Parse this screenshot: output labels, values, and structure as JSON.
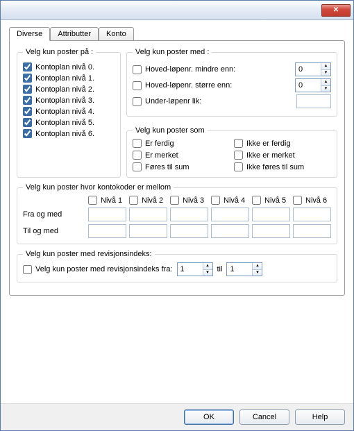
{
  "tabs": {
    "diverse": "Diverse",
    "attributter": "Attributter",
    "konto": "Konto"
  },
  "level_group": {
    "legend": "Velg kun poster på :",
    "items": [
      "Kontoplan nivå 0.",
      "Kontoplan nivå 1.",
      "Kontoplan nivå 2.",
      "Kontoplan nivå 3.",
      "Kontoplan nivå 4.",
      "Kontoplan nivå 5.",
      "Kontoplan nivå 6."
    ]
  },
  "med_group": {
    "legend": "Velg kun poster med :",
    "less_label": "Hoved-løpenr. mindre enn:",
    "less_value": "0",
    "greater_label": "Hoved-løpenr. større enn:",
    "greater_value": "0",
    "under_label": "Under-løpenr lik:",
    "under_value": ""
  },
  "som_group": {
    "legend": "Velg kun poster som",
    "items": [
      "Er ferdig",
      "Ikke er ferdig",
      "Er merket",
      "Ikke er merket",
      "Føres til sum",
      "Ikke føres til sum"
    ]
  },
  "range_group": {
    "legend": "Velg kun poster hvor kontokoder er mellom",
    "headers": [
      "Nivå 1",
      "Nivå 2",
      "Nivå 3",
      "Nivå 4",
      "Nivå 5",
      "Nivå 6"
    ],
    "from_label": "Fra og med",
    "to_label": "Til og med"
  },
  "rev_group": {
    "legend": "Velg kun poster med revisjonsindeks:",
    "check_label": "Velg kun poster med revisjonsindeks fra:",
    "from": "1",
    "to": "1",
    "between": "til"
  },
  "buttons": {
    "ok": "OK",
    "cancel": "Cancel",
    "help": "Help"
  }
}
